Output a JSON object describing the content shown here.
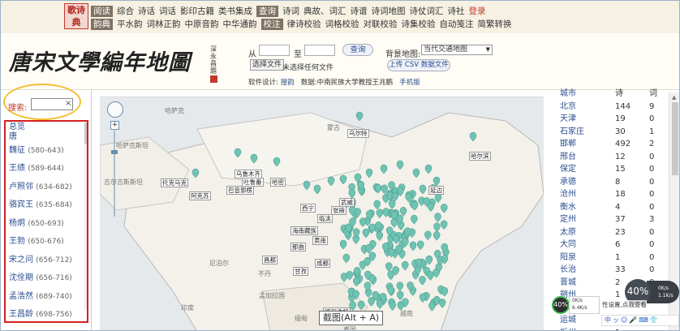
{
  "nav": {
    "seal_text": "歌诗典",
    "row1_tag": "阅读",
    "row1": [
      "综合",
      "诗话",
      "词话",
      "影印古籍",
      "类书集成"
    ],
    "row1_tag2": "查询",
    "row1b": [
      "诗词",
      "典故、词汇",
      "诗谱",
      "诗词地图",
      "诗仗词汇",
      "诗社"
    ],
    "login": "登录",
    "row2_tag": "韵典",
    "row2": [
      "平水韵",
      "词林正韵",
      "中原音韵",
      "中华通韵"
    ],
    "row2_tag2": "校注",
    "row2b": [
      "律诗校验",
      "词格校验",
      "对联校验",
      "诗集校验",
      "自动笺注",
      "简繁转换"
    ]
  },
  "header": {
    "title": "唐宋文學編年地圖",
    "signature": "深永昌題",
    "from_label": "从",
    "to_label": "至",
    "query_button": "查询",
    "bgmap_label": "背景地图:",
    "bgmap_value": "当代交通地图",
    "choose_file": "选择文件",
    "no_file": "未选择任何文件",
    "upload_csv": "上传 CSV 数据文件",
    "credits_prefix": "软件设计:",
    "credits_author": "搜韵",
    "credits_data": "数据:中南民族大学教授王兆鹏",
    "mobile": "手机版"
  },
  "sidebar": {
    "search_label": "搜索:",
    "clear": "×",
    "items": [
      {
        "name": "总览",
        "years": ""
      },
      {
        "name": "唐",
        "years": ""
      },
      {
        "name": "魏征",
        "years": "(580-643)"
      },
      {
        "name": "王绩",
        "years": "(589-644)"
      },
      {
        "name": "卢照邻",
        "years": "(634-682)"
      },
      {
        "name": "骆宾王",
        "years": "(635-684)"
      },
      {
        "name": "杨炯",
        "years": "(650-693)"
      },
      {
        "name": "王勃",
        "years": "(650-676)"
      },
      {
        "name": "宋之问",
        "years": "(656-712)"
      },
      {
        "name": "沈佺期",
        "years": "(656-716)"
      },
      {
        "name": "孟浩然",
        "years": "(689-740)"
      },
      {
        "name": "王昌龄",
        "years": "(698-756)"
      }
    ]
  },
  "map": {
    "regions": [
      "蒙古",
      "哈萨克斯坦",
      "吉尔吉斯斯坦",
      "中国",
      "缅甸",
      "泰国",
      "越南",
      "老挝",
      "孟加拉国",
      "印度",
      "尼泊尔",
      "不丹",
      "哈萨克"
    ],
    "cities": [
      "托克马克",
      "阿克苏",
      "乌鲁木齐",
      "吐鲁番",
      "巴音郭楞",
      "哈密",
      "临洮",
      "西宁",
      "武威",
      "张掖",
      "海南藏族",
      "成都",
      "甘孜",
      "黄南",
      "乌尔特",
      "哈尔滨",
      "昌都",
      "那曲",
      "延边",
      "呼和浩特"
    ],
    "tooltip": "截图(Alt + A)"
  },
  "table": {
    "rows": [
      {
        "city": "城市",
        "a": "诗",
        "b": "词"
      },
      {
        "city": "北京",
        "a": "144",
        "b": "9"
      },
      {
        "city": "天津",
        "a": "19",
        "b": "0"
      },
      {
        "city": "石家庄",
        "a": "30",
        "b": "1"
      },
      {
        "city": "邯郸",
        "a": "492",
        "b": "2"
      },
      {
        "city": "邢台",
        "a": "12",
        "b": "0"
      },
      {
        "city": "保定",
        "a": "15",
        "b": "0"
      },
      {
        "city": "承德",
        "a": "8",
        "b": "0"
      },
      {
        "city": "沧州",
        "a": "18",
        "b": "0"
      },
      {
        "city": "衡水",
        "a": "4",
        "b": "0"
      },
      {
        "city": "定州",
        "a": "37",
        "b": "3"
      },
      {
        "city": "太原",
        "a": "23",
        "b": "0"
      },
      {
        "city": "大同",
        "a": "6",
        "b": "0"
      },
      {
        "city": "阳泉",
        "a": "1",
        "b": "0"
      },
      {
        "city": "长治",
        "a": "33",
        "b": "0"
      },
      {
        "city": "晋城",
        "a": "2",
        "b": "0"
      },
      {
        "city": "朔州",
        "a": "1",
        "b": "0"
      },
      {
        "city": "晋中",
        "a": "",
        "b": ""
      },
      {
        "city": "运城",
        "a": "",
        "b": ""
      },
      {
        "city": "忻州",
        "a": "1",
        "b": ""
      }
    ]
  },
  "overlays": {
    "cpu1": "40%",
    "net1": "0K/s",
    "net2": "6.4K/s",
    "cpu2": "40%",
    "net3": "0K/s",
    "net4": "1.1K/s",
    "ime_hint": "性设置,点我查看",
    "ime": "中ッ☺🎤⌨👕"
  },
  "colors": {
    "accent": "#2a4d8f",
    "pin": "#6fc3b2",
    "highlight_box": "#d62020",
    "ellipse": "#f2c033"
  }
}
